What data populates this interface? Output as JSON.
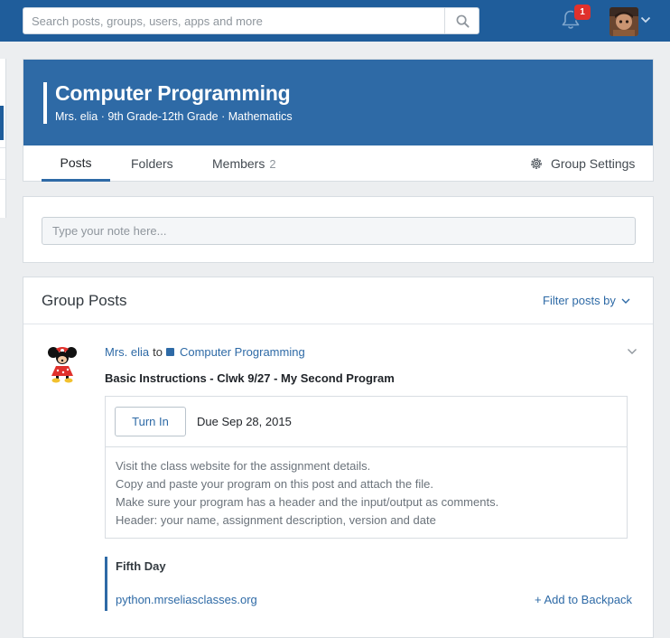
{
  "topbar": {
    "search_placeholder": "Search posts, groups, users, apps and more",
    "search_icon": "search-icon",
    "notifications_icon": "bell-icon",
    "notification_count": "1",
    "avatar_icon": "user-avatar",
    "menu_icon": "chevron-down-icon",
    "brand_color": "#1f5d9b"
  },
  "group": {
    "title": "Computer Programming",
    "subtitle": "Mrs. elia · 9th Grade-12th Grade · Mathematics",
    "banner_color": "#2e6aa6",
    "tabs": [
      {
        "label": "Posts",
        "active": true
      },
      {
        "label": "Folders"
      },
      {
        "label": "Members",
        "count": "2"
      }
    ],
    "settings_label": "Group Settings",
    "settings_icon": "gear-icon"
  },
  "composer": {
    "placeholder": "Type your note here..."
  },
  "posts": {
    "heading": "Group Posts",
    "filter_label": "Filter posts by",
    "items": [
      {
        "author": "Mrs. elia",
        "to_text": "to",
        "group": "Computer Programming",
        "title": "Basic Instructions - Clwk 9/27 - My Second Program",
        "turn_in_label": "Turn In",
        "due": "Due Sep 28, 2015",
        "body": [
          "Visit the class website for the assignment details.",
          "Copy and paste your program on this post and attach the file.",
          "Make sure your program has a header and the input/output as comments.",
          "Header: your name, assignment description, version and date"
        ],
        "attachment_title": "Fifth Day",
        "attachment_link": "python.mrseliasclasses.org",
        "backpack_label": "+ Add to Backpack"
      }
    ]
  }
}
